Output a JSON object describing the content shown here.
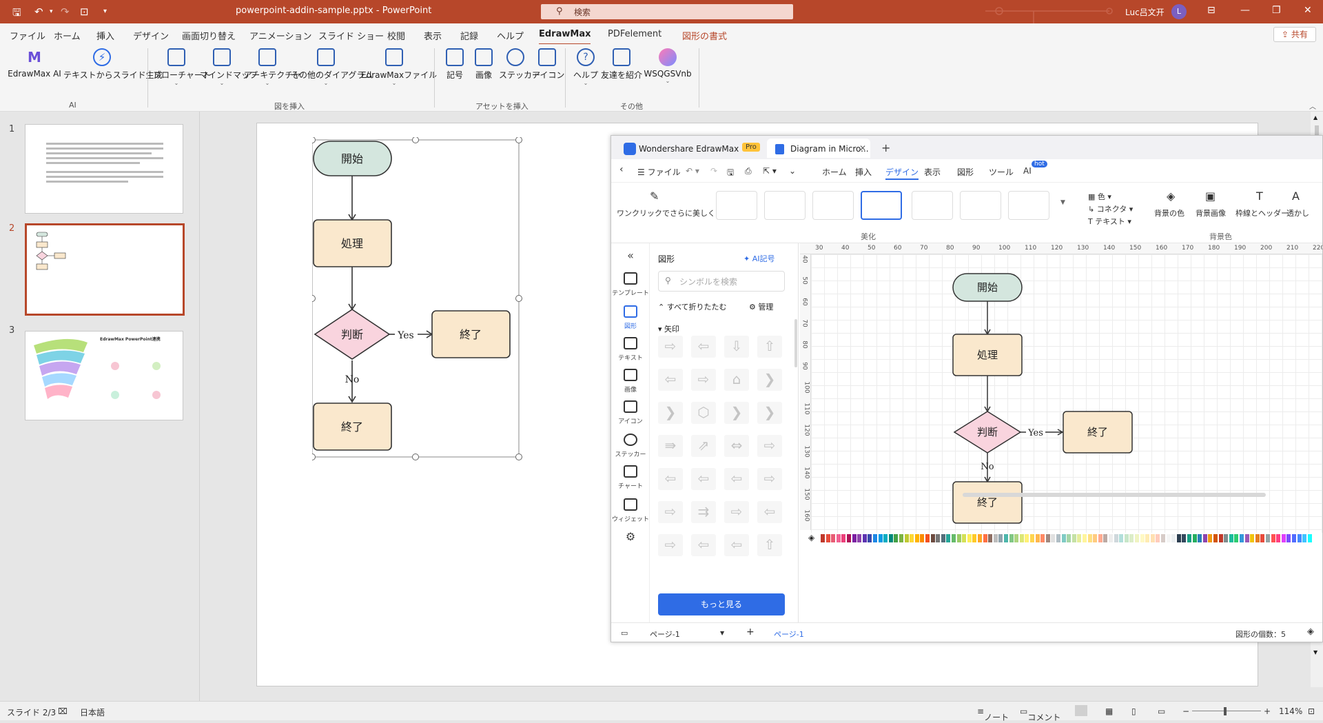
{
  "titlebar": {
    "file_name": "powerpoint-addin-sample.pptx",
    "separator": " - ",
    "app_name": "PowerPoint",
    "search_placeholder": "検索",
    "user_name": "Luc吕文开",
    "user_initial": "L",
    "accent_color": "#b7472a"
  },
  "menu": {
    "tabs": [
      "ファイル",
      "ホーム",
      "挿入",
      "デザイン",
      "画面切り替え",
      "アニメーション",
      "スライド ショー",
      "校閲",
      "表示",
      "記録",
      "ヘルプ",
      "EdrawMax",
      "PDFelement",
      "図形の書式"
    ],
    "active_tab": "EdrawMax",
    "share_label": "共有"
  },
  "ribbon": {
    "groups": [
      {
        "label": "AI",
        "buttons": [
          "EdrawMax AI",
          "テキストからスライド生成"
        ]
      },
      {
        "label": "図を挿入",
        "buttons": [
          "フローチャート",
          "マインドマップ",
          "アーキテクチャ",
          "その他のダイアグラム",
          "EdrawMaxファイル"
        ]
      },
      {
        "label": "アセットを挿入",
        "buttons": [
          "記号",
          "画像",
          "ステッカー",
          "アイコン"
        ]
      },
      {
        "label": "その他",
        "buttons": [
          "ヘルプ",
          "友達を紹介",
          "WSQGSVnb"
        ]
      }
    ]
  },
  "slides": {
    "numbers": [
      "1",
      "2",
      "3"
    ],
    "selected": 2,
    "slide3_title": "EdrawMax PowerPoint連携"
  },
  "flowchart": {
    "start": "開始",
    "process": "処理",
    "decision": "判断",
    "yes_label": "Yes",
    "no_label": "No",
    "end_right": "終了",
    "end_bottom": "終了"
  },
  "edrawmax": {
    "tabs": [
      "Wondershare EdrawMax",
      "Diagram in Micro..."
    ],
    "pro_badge": "Pro",
    "file_menu": "ファイル",
    "menu_items": [
      "ホーム",
      "挿入",
      "デザイン",
      "表示",
      "図形",
      "ツール",
      "AI"
    ],
    "active_menu": "デザイン",
    "hot_badge": "hot",
    "beautify_label": "ワンクリックでさらに美しく",
    "beautify_group": "美化",
    "option_color": "色",
    "option_connector": "コネクタ",
    "option_text": "テキスト",
    "bg_color": "背景の色",
    "bg_image": "背景画像",
    "border_header": "枠線とヘッダー",
    "watermark": "透かし",
    "bg_group": "背景色",
    "sidebar": [
      "テンプレート",
      "図形",
      "テキスト",
      "画像",
      "アイコン",
      "ステッカー",
      "チャート",
      "ウィジェット"
    ],
    "library_title": "図形",
    "ai_symbol": "AI記号",
    "search_placeholder": "シンボルを検索",
    "collapse_all": "すべて折りたたむ",
    "manage": "管理",
    "category": "矢印",
    "more_button": "もっと見る",
    "page_selector": "ページ-1",
    "page_tab": "ページ-1",
    "shape_count": "図形の個数：5",
    "ruler_top": [
      "30",
      "40",
      "50",
      "60",
      "70",
      "80",
      "90",
      "100",
      "110",
      "120",
      "130",
      "140",
      "150",
      "160",
      "170",
      "180",
      "190",
      "200",
      "210",
      "220"
    ],
    "ruler_left": [
      "40",
      "50",
      "60",
      "70",
      "80",
      "90",
      "100",
      "110",
      "120",
      "130",
      "140",
      "150",
      "160"
    ],
    "palette": [
      "#c0392b",
      "#e74c3c",
      "#e85d75",
      "#f06292",
      "#ec407a",
      "#ad1457",
      "#7b1fa2",
      "#8e44ad",
      "#5e35b1",
      "#3949ab",
      "#1e88e5",
      "#039be5",
      "#00acc1",
      "#00897b",
      "#43a047",
      "#7cb342",
      "#c0ca33",
      "#fdd835",
      "#ffb300",
      "#fb8c00",
      "#f4511e",
      "#6d4c41",
      "#757575",
      "#546e7a",
      "#26a69a",
      "#66bb6a",
      "#9ccc65",
      "#d4e157",
      "#ffee58",
      "#ffca28",
      "#ffa726",
      "#ff7043",
      "#8d6e63",
      "#bdbdbd",
      "#90a4ae",
      "#4db6ac",
      "#81c784",
      "#aed581",
      "#dce775",
      "#fff176",
      "#ffd54f",
      "#ffb74d",
      "#ff8a65",
      "#a1887f",
      "#e0e0e0",
      "#b0bec5",
      "#80cbc4",
      "#a5d6a7",
      "#c5e1a5",
      "#e6ee9c",
      "#fff59d",
      "#ffe082",
      "#ffcc80",
      "#ffab91",
      "#bcaaa4",
      "#eeeeee",
      "#cfd8dc",
      "#b2dfdb",
      "#c8e6c9",
      "#dcedc8",
      "#f0f4c3",
      "#fff9c4",
      "#ffecb3",
      "#ffe0b2",
      "#ffccbc",
      "#d7ccc8",
      "#f5f5f5",
      "#eceff1",
      "#2c3e50",
      "#34495e",
      "#16a085",
      "#27ae60",
      "#2980b9",
      "#8e44ad",
      "#f39c12",
      "#d35400",
      "#c0392b",
      "#7f8c8d",
      "#1abc9c",
      "#2ecc71",
      "#3498db",
      "#9b59b6",
      "#f1c40f",
      "#e67e22",
      "#e74c3c",
      "#95a5a6",
      "#ff5252",
      "#ff4081",
      "#e040fb",
      "#7c4dff",
      "#536dfe",
      "#448aff",
      "#40c4ff",
      "#18ffff"
    ]
  },
  "status": {
    "slide_indicator": "スライド 2/3",
    "language": "日本語",
    "notes": "ノート",
    "comments": "コメント",
    "zoom": "114%"
  },
  "colors": {
    "start_fill": "#d4e6de",
    "process_fill": "#fae8cd",
    "decision_fill": "#f9d4de",
    "edraw_blue": "#2f6ce5"
  }
}
